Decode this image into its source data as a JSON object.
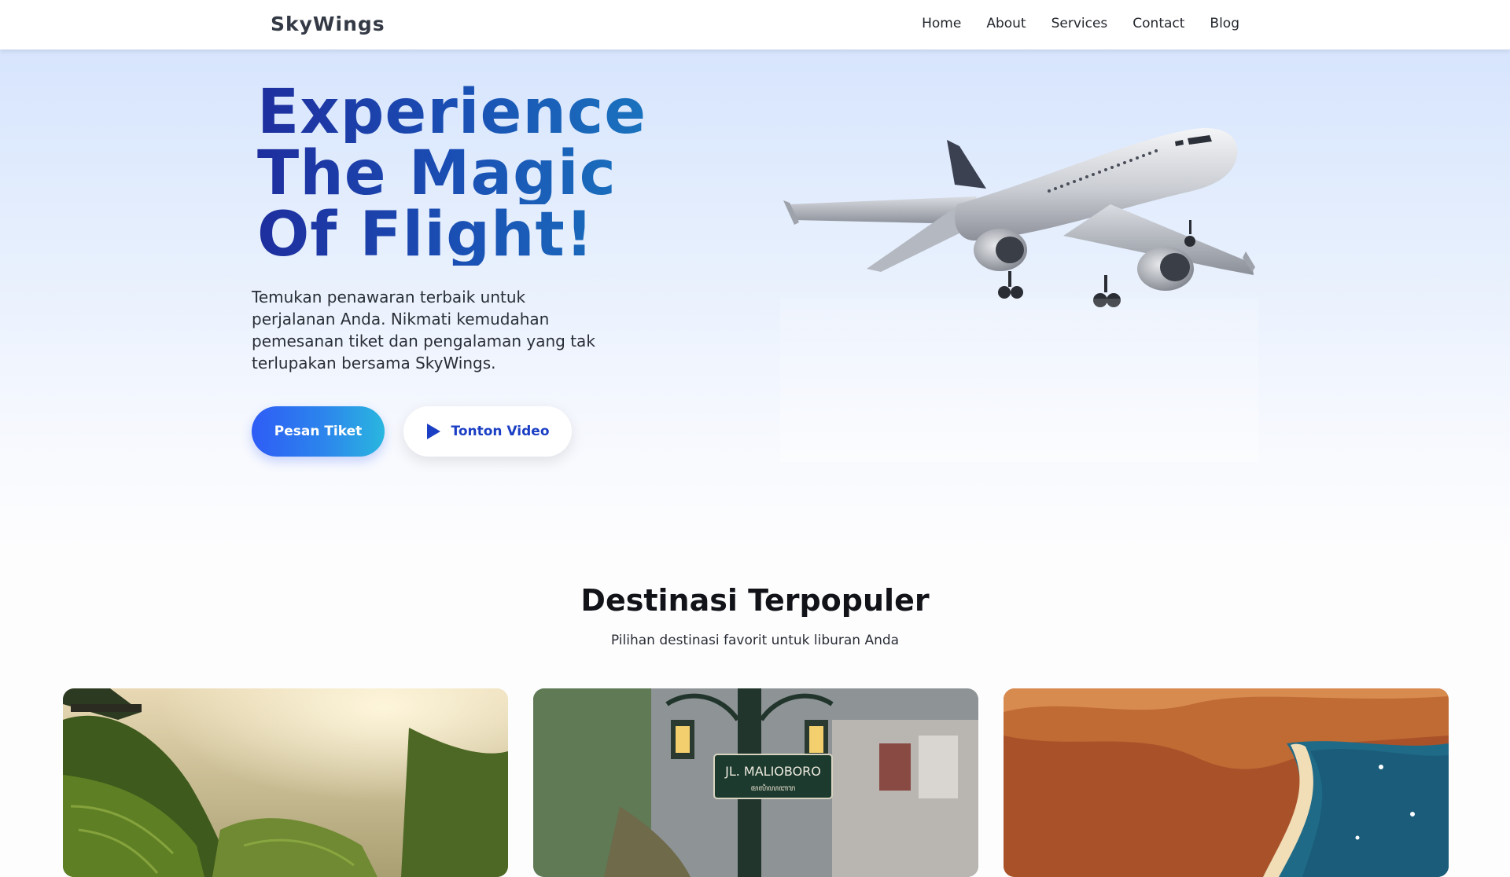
{
  "navbar": {
    "brand": "SkyWings",
    "links": [
      "Home",
      "About",
      "Services",
      "Contact",
      "Blog"
    ]
  },
  "hero": {
    "title_lines": [
      "Experience",
      "The Magic",
      "Of Flight!"
    ],
    "subtitle": "Temukan penawaran terbaik untuk perjalanan Anda. Nikmati kemudahan pemesanan tiket dan pengalaman yang tak terlupakan bersama SkyWings.",
    "primary_button": "Pesan Tiket",
    "secondary_button": "Tonton Video",
    "secondary_icon": "play-icon",
    "image_icon": "airplane-image"
  },
  "destinations": {
    "title": "Destinasi Terpopuler",
    "subtitle": "Pilihan destinasi favorit untuk liburan Anda",
    "cards": [
      {
        "image": "rice-terraces-image"
      },
      {
        "image": "malioboro-street-image",
        "sign_text": "JL. MALIOBORO",
        "sign_subtext": "ꦩꦭꦶꦪꦧꦫ"
      },
      {
        "image": "island-coast-image"
      }
    ]
  },
  "colors": {
    "accent": "#2e5cf6",
    "title_gradient_start": "#1e2e9e",
    "title_gradient_end": "#1a7cc0",
    "text": "#2a2e36"
  }
}
